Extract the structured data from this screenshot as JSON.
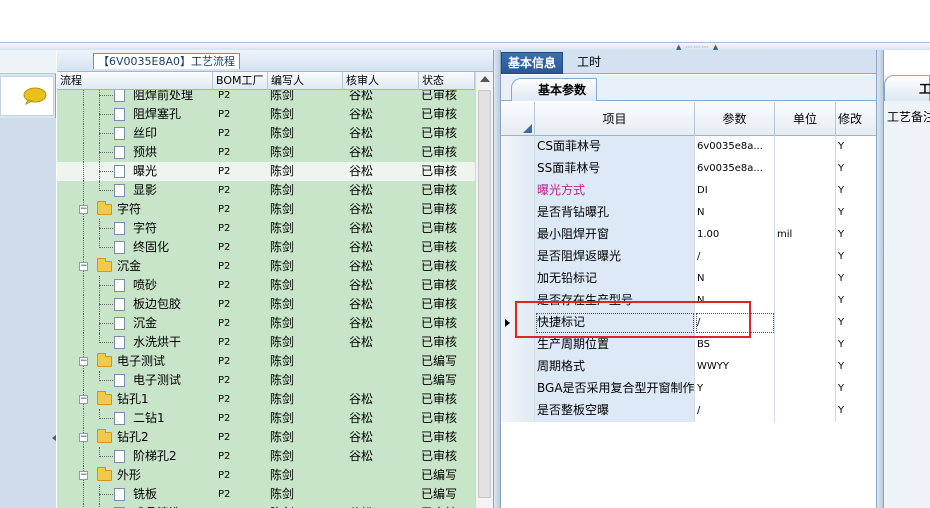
{
  "tree_panel": {
    "title": "【6V0035E8A0】工艺流程",
    "columns": [
      "流程",
      "BOM工厂",
      "编写人",
      "核审人",
      "状态"
    ],
    "rows": [
      {
        "kind": "doc",
        "name": "阻焊前处理",
        "bom": "P2",
        "author": "陈剑",
        "reviewer": "谷松",
        "status": "已审核"
      },
      {
        "kind": "doc",
        "name": "阻焊塞孔",
        "bom": "P2",
        "author": "陈剑",
        "reviewer": "谷松",
        "status": "已审核"
      },
      {
        "kind": "doc",
        "name": "丝印",
        "bom": "P2",
        "author": "陈剑",
        "reviewer": "谷松",
        "status": "已审核"
      },
      {
        "kind": "doc",
        "name": "预烘",
        "bom": "P2",
        "author": "陈剑",
        "reviewer": "谷松",
        "status": "已审核"
      },
      {
        "kind": "doc",
        "name": "曝光",
        "bom": "P2",
        "author": "陈剑",
        "reviewer": "谷松",
        "status": "已审核",
        "selected": true
      },
      {
        "kind": "doc-last",
        "name": "显影",
        "bom": "P2",
        "author": "陈剑",
        "reviewer": "谷松",
        "status": "已审核"
      },
      {
        "kind": "folder",
        "name": "字符",
        "bom": "P2",
        "author": "陈剑",
        "reviewer": "谷松",
        "status": "已审核"
      },
      {
        "kind": "doc",
        "name": "字符",
        "bom": "P2",
        "author": "陈剑",
        "reviewer": "谷松",
        "status": "已审核"
      },
      {
        "kind": "doc-last",
        "name": "终固化",
        "bom": "P2",
        "author": "陈剑",
        "reviewer": "谷松",
        "status": "已审核"
      },
      {
        "kind": "folder",
        "name": "沉金",
        "bom": "P2",
        "author": "陈剑",
        "reviewer": "谷松",
        "status": "已审核"
      },
      {
        "kind": "doc",
        "name": "喷砂",
        "bom": "P2",
        "author": "陈剑",
        "reviewer": "谷松",
        "status": "已审核"
      },
      {
        "kind": "doc",
        "name": "板边包胶",
        "bom": "P2",
        "author": "陈剑",
        "reviewer": "谷松",
        "status": "已审核"
      },
      {
        "kind": "doc",
        "name": "沉金",
        "bom": "P2",
        "author": "陈剑",
        "reviewer": "谷松",
        "status": "已审核"
      },
      {
        "kind": "doc-last",
        "name": "水洗烘干",
        "bom": "P2",
        "author": "陈剑",
        "reviewer": "谷松",
        "status": "已审核"
      },
      {
        "kind": "folder",
        "name": "电子测试",
        "bom": "P2",
        "author": "陈剑",
        "reviewer": "",
        "status": "已编写"
      },
      {
        "kind": "doc-last",
        "name": "电子测试",
        "bom": "P2",
        "author": "陈剑",
        "reviewer": "",
        "status": "已编写"
      },
      {
        "kind": "folder",
        "name": "钻孔1",
        "bom": "P2",
        "author": "陈剑",
        "reviewer": "谷松",
        "status": "已审核"
      },
      {
        "kind": "doc-last",
        "name": "二钻1",
        "bom": "P2",
        "author": "陈剑",
        "reviewer": "谷松",
        "status": "已审核"
      },
      {
        "kind": "folder",
        "name": "钻孔2",
        "bom": "P2",
        "author": "陈剑",
        "reviewer": "谷松",
        "status": "已审核"
      },
      {
        "kind": "doc-last",
        "name": "阶梯孔2",
        "bom": "P2",
        "author": "陈剑",
        "reviewer": "谷松",
        "status": "已审核"
      },
      {
        "kind": "folder",
        "name": "外形",
        "bom": "P2",
        "author": "陈剑",
        "reviewer": "",
        "status": "已编写"
      },
      {
        "kind": "doc",
        "name": "铣板",
        "bom": "P2",
        "author": "陈剑",
        "reviewer": "",
        "status": "已编写"
      },
      {
        "kind": "doc",
        "name": "成品清洗",
        "bom": "P2",
        "author": "陈剑",
        "reviewer": "谷松",
        "status": "已审核"
      }
    ]
  },
  "right_tabs": [
    "基本信息",
    "工时"
  ],
  "sub_tab": "基本参数",
  "grid": {
    "columns": [
      "项目",
      "参数",
      "单位",
      "修改"
    ],
    "rows": [
      {
        "item": "CS面菲林号",
        "param": "6v0035e8a...",
        "unit": "",
        "mod": "Y"
      },
      {
        "item": "SS面菲林号",
        "param": "6v0035e8a...",
        "unit": "",
        "mod": "Y"
      },
      {
        "item": "曝光方式",
        "param": "DI",
        "unit": "",
        "mod": "Y",
        "item_color": "#c0208c"
      },
      {
        "item": "是否背钻曝孔",
        "param": "N",
        "unit": "",
        "mod": "Y"
      },
      {
        "item": "最小阻焊开窗",
        "param": "1.00",
        "unit": "mil",
        "mod": "Y"
      },
      {
        "item": "是否阻焊返曝光",
        "param": "/",
        "unit": "",
        "mod": "Y"
      },
      {
        "item": "加无铅标记",
        "param": "N",
        "unit": "",
        "mod": "Y"
      },
      {
        "item": "是否存在生产型号",
        "param": "N",
        "unit": "",
        "mod": "Y"
      },
      {
        "item": "快捷标记",
        "param": "/",
        "unit": "",
        "mod": "Y",
        "current": true
      },
      {
        "item": "生产周期位置",
        "param": "BS",
        "unit": "",
        "mod": "Y"
      },
      {
        "item": "周期格式",
        "param": "WWYY",
        "unit": "",
        "mod": "Y"
      },
      {
        "item": "BGA是否采用复合型开窗制作",
        "param": "Y",
        "unit": "",
        "mod": "Y"
      },
      {
        "item": "是否整板空曝",
        "param": "/",
        "unit": "",
        "mod": "Y"
      }
    ]
  },
  "far_panel": {
    "tab": "工",
    "label": "工艺备注"
  },
  "colors": {
    "tree_bg": "#c9e5c9",
    "accent_tab": "#2b5796",
    "highlight_box": "#e02424"
  }
}
